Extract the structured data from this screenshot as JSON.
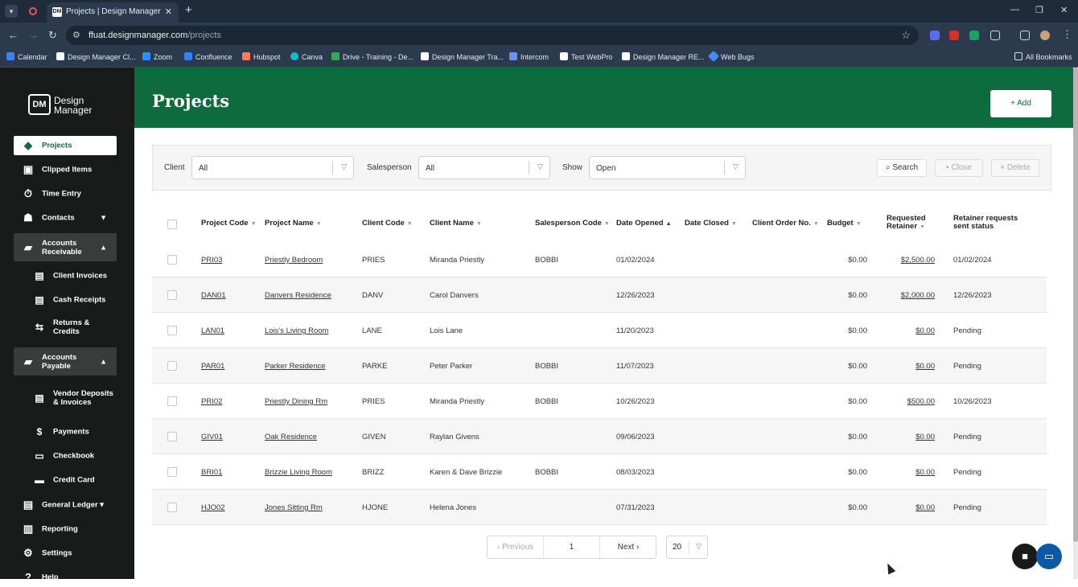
{
  "browser": {
    "tab_title": "Projects | Design Manager",
    "tab_favicon": "DM",
    "url_host": "ffuat.designmanager.com",
    "url_path": "/projects",
    "all_bookmarks": "All Bookmarks",
    "bookmarks": [
      {
        "label": "Calendar",
        "color": "#3b82f6"
      },
      {
        "label": "Design Manager Cl...",
        "color": "#ffffff"
      },
      {
        "label": "Zoom",
        "color": "#2d8cff"
      },
      {
        "label": "Confluence",
        "color": "#2684ff"
      },
      {
        "label": "Hubspot",
        "color": "#ff7a59"
      },
      {
        "label": "Canva",
        "color": "#00c4cc"
      },
      {
        "label": "Drive - Training - De...",
        "color": "#34a853"
      },
      {
        "label": "Design Manager Tra...",
        "color": "#ffffff"
      },
      {
        "label": "Intercom",
        "color": "#6c8ef5"
      },
      {
        "label": "Test WebPro",
        "color": "#ffffff"
      },
      {
        "label": "Design Manager RE...",
        "color": "#ffffff"
      },
      {
        "label": "Web Bugs",
        "color": "#4a8af4"
      }
    ]
  },
  "sidebar": {
    "logo_mark": "DM",
    "logo_line1": "Design",
    "logo_line2": "Manager",
    "items": [
      {
        "label": "Projects",
        "icon": "layers-icon"
      },
      {
        "label": "Clipped Items",
        "icon": "clipboard-icon"
      },
      {
        "label": "Time Entry",
        "icon": "stopwatch-icon"
      },
      {
        "label": "Contacts",
        "icon": "contacts-icon"
      },
      {
        "label": "Accounts Receivable",
        "icon": "folder-icon"
      },
      {
        "label": "Client Invoices",
        "icon": "invoice-icon"
      },
      {
        "label": "Cash Receipts",
        "icon": "receipt-icon"
      },
      {
        "label": "Returns & Credits",
        "icon": "returns-icon"
      },
      {
        "label": "Accounts Payable",
        "icon": "folder-icon"
      },
      {
        "label": "Vendor Deposits & Invoices",
        "icon": "invoice-icon"
      },
      {
        "label": "Payments",
        "icon": "dollar-icon"
      },
      {
        "label": "Checkbook",
        "icon": "checkbook-icon"
      },
      {
        "label": "Credit Card",
        "icon": "credit-card-icon"
      },
      {
        "label": "General Ledger",
        "icon": "ledger-icon"
      },
      {
        "label": "Reporting",
        "icon": "chart-icon"
      },
      {
        "label": "Settings",
        "icon": "gear-icon"
      },
      {
        "label": "Help",
        "icon": "help-icon"
      }
    ]
  },
  "page": {
    "title": "Projects",
    "add_label": "Add"
  },
  "filters": {
    "client_label": "Client",
    "client_value": "All",
    "salesperson_label": "Salesperson",
    "salesperson_value": "All",
    "show_label": "Show",
    "show_value": "Open",
    "search_label": "Search",
    "close_label": "Close",
    "delete_label": "Delete"
  },
  "table": {
    "headers": {
      "project_code": "Project Code",
      "project_name": "Project Name",
      "client_code": "Client Code",
      "client_name": "Client Name",
      "salesperson_code": "Salesperson Code",
      "date_opened": "Date Opened",
      "date_closed": "Date Closed",
      "client_order_no": "Client Order No.",
      "budget": "Budget",
      "requested_retainer_1": "Requested",
      "requested_retainer_2": "Retainer",
      "retainer_status_1": "Retainer requests",
      "retainer_status_2": "sent status"
    },
    "rows": [
      {
        "project_code": "PRI03",
        "project_name": "Priestly Bedroom",
        "client_code": "PRIES",
        "client_name": "Miranda Priestly",
        "salesperson": "BOBBI",
        "date_opened": "01/02/2024",
        "date_closed": "",
        "order_no": "",
        "budget": "$0.00",
        "retainer": "$2,500.00",
        "status": "01/02/2024"
      },
      {
        "project_code": "DAN01",
        "project_name": "Danvers Residence",
        "client_code": "DANV",
        "client_name": "Carol Danvers",
        "salesperson": "",
        "date_opened": "12/26/2023",
        "date_closed": "",
        "order_no": "",
        "budget": "$0.00",
        "retainer": "$2,000.00",
        "status": "12/26/2023"
      },
      {
        "project_code": "LAN01",
        "project_name": "Lois's Living Room",
        "client_code": "LANE",
        "client_name": "Lois Lane",
        "salesperson": "",
        "date_opened": "11/20/2023",
        "date_closed": "",
        "order_no": "",
        "budget": "$0.00",
        "retainer": "$0.00",
        "status": "Pending"
      },
      {
        "project_code": "PAR01",
        "project_name": "Parker Residence",
        "client_code": "PARKE",
        "client_name": "Peter Parker",
        "salesperson": "BOBBI",
        "date_opened": "11/07/2023",
        "date_closed": "",
        "order_no": "",
        "budget": "$0.00",
        "retainer": "$0.00",
        "status": "Pending"
      },
      {
        "project_code": "PRI02",
        "project_name": "Priestly Dining Rm",
        "client_code": "PRIES",
        "client_name": "Miranda Priestly",
        "salesperson": "BOBBI",
        "date_opened": "10/26/2023",
        "date_closed": "",
        "order_no": "",
        "budget": "$0.00",
        "retainer": "$500.00",
        "status": "10/26/2023"
      },
      {
        "project_code": "GIV01",
        "project_name": "Oak Residence",
        "client_code": "GIVEN",
        "client_name": "Raylan Givens",
        "salesperson": "",
        "date_opened": "09/06/2023",
        "date_closed": "",
        "order_no": "",
        "budget": "$0.00",
        "retainer": "$0.00",
        "status": "Pending"
      },
      {
        "project_code": "BRI01",
        "project_name": "Brizzie Living Room",
        "client_code": "BRIZZ",
        "client_name": "Karen & Dave Brizzie",
        "salesperson": "BOBBI",
        "date_opened": "08/03/2023",
        "date_closed": "",
        "order_no": "",
        "budget": "$0.00",
        "retainer": "$0.00",
        "status": "Pending"
      },
      {
        "project_code": "HJO02",
        "project_name": "Jones Sitting Rm",
        "client_code": "HJONE",
        "client_name": "Helena Jones",
        "salesperson": "",
        "date_opened": "07/31/2023",
        "date_closed": "",
        "order_no": "",
        "budget": "$0.00",
        "retainer": "$0.00",
        "status": "Pending"
      }
    ]
  },
  "pagination": {
    "previous_label": "Previous",
    "page_number": "1",
    "next_label": "Next",
    "page_size": "20"
  },
  "colors": {
    "brand_green": "#0d6b3d",
    "sidebar_bg": "#191a1a"
  }
}
